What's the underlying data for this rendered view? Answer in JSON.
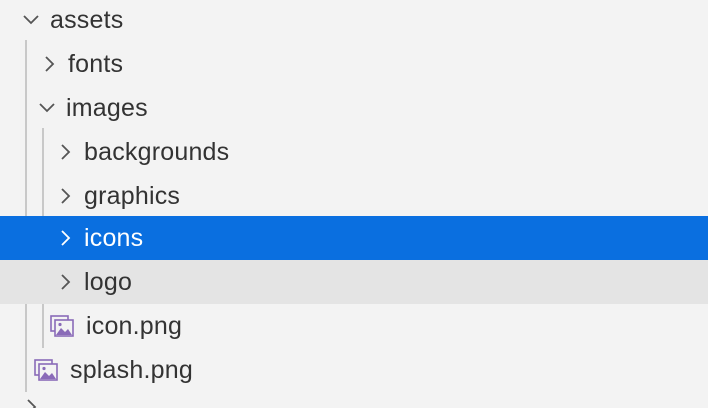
{
  "explorer": {
    "items": [
      {
        "label": "assets",
        "kind": "folder",
        "expanded": true,
        "icon": "chevron-down-icon"
      },
      {
        "label": "fonts",
        "kind": "folder",
        "expanded": false,
        "icon": "chevron-right-icon"
      },
      {
        "label": "images",
        "kind": "folder",
        "expanded": true,
        "icon": "chevron-down-icon"
      },
      {
        "label": "backgrounds",
        "kind": "folder",
        "expanded": false,
        "icon": "chevron-right-icon"
      },
      {
        "label": "graphics",
        "kind": "folder",
        "expanded": false,
        "icon": "chevron-right-icon"
      },
      {
        "label": "icons",
        "kind": "folder",
        "expanded": false,
        "selected": true,
        "icon": "chevron-right-icon"
      },
      {
        "label": "logo",
        "kind": "folder",
        "expanded": false,
        "hovered": true,
        "icon": "chevron-right-icon"
      },
      {
        "label": "icon.png",
        "kind": "file",
        "icon": "image-file-icon"
      },
      {
        "label": "splash.png",
        "kind": "file",
        "icon": "image-file-icon"
      }
    ]
  },
  "colors": {
    "background": "#f3f3f3",
    "selection": "#0a6fe0",
    "hover": "#e4e4e4",
    "text": "#333333",
    "selected_text": "#ffffff",
    "image_icon": "#8a6bb8"
  }
}
